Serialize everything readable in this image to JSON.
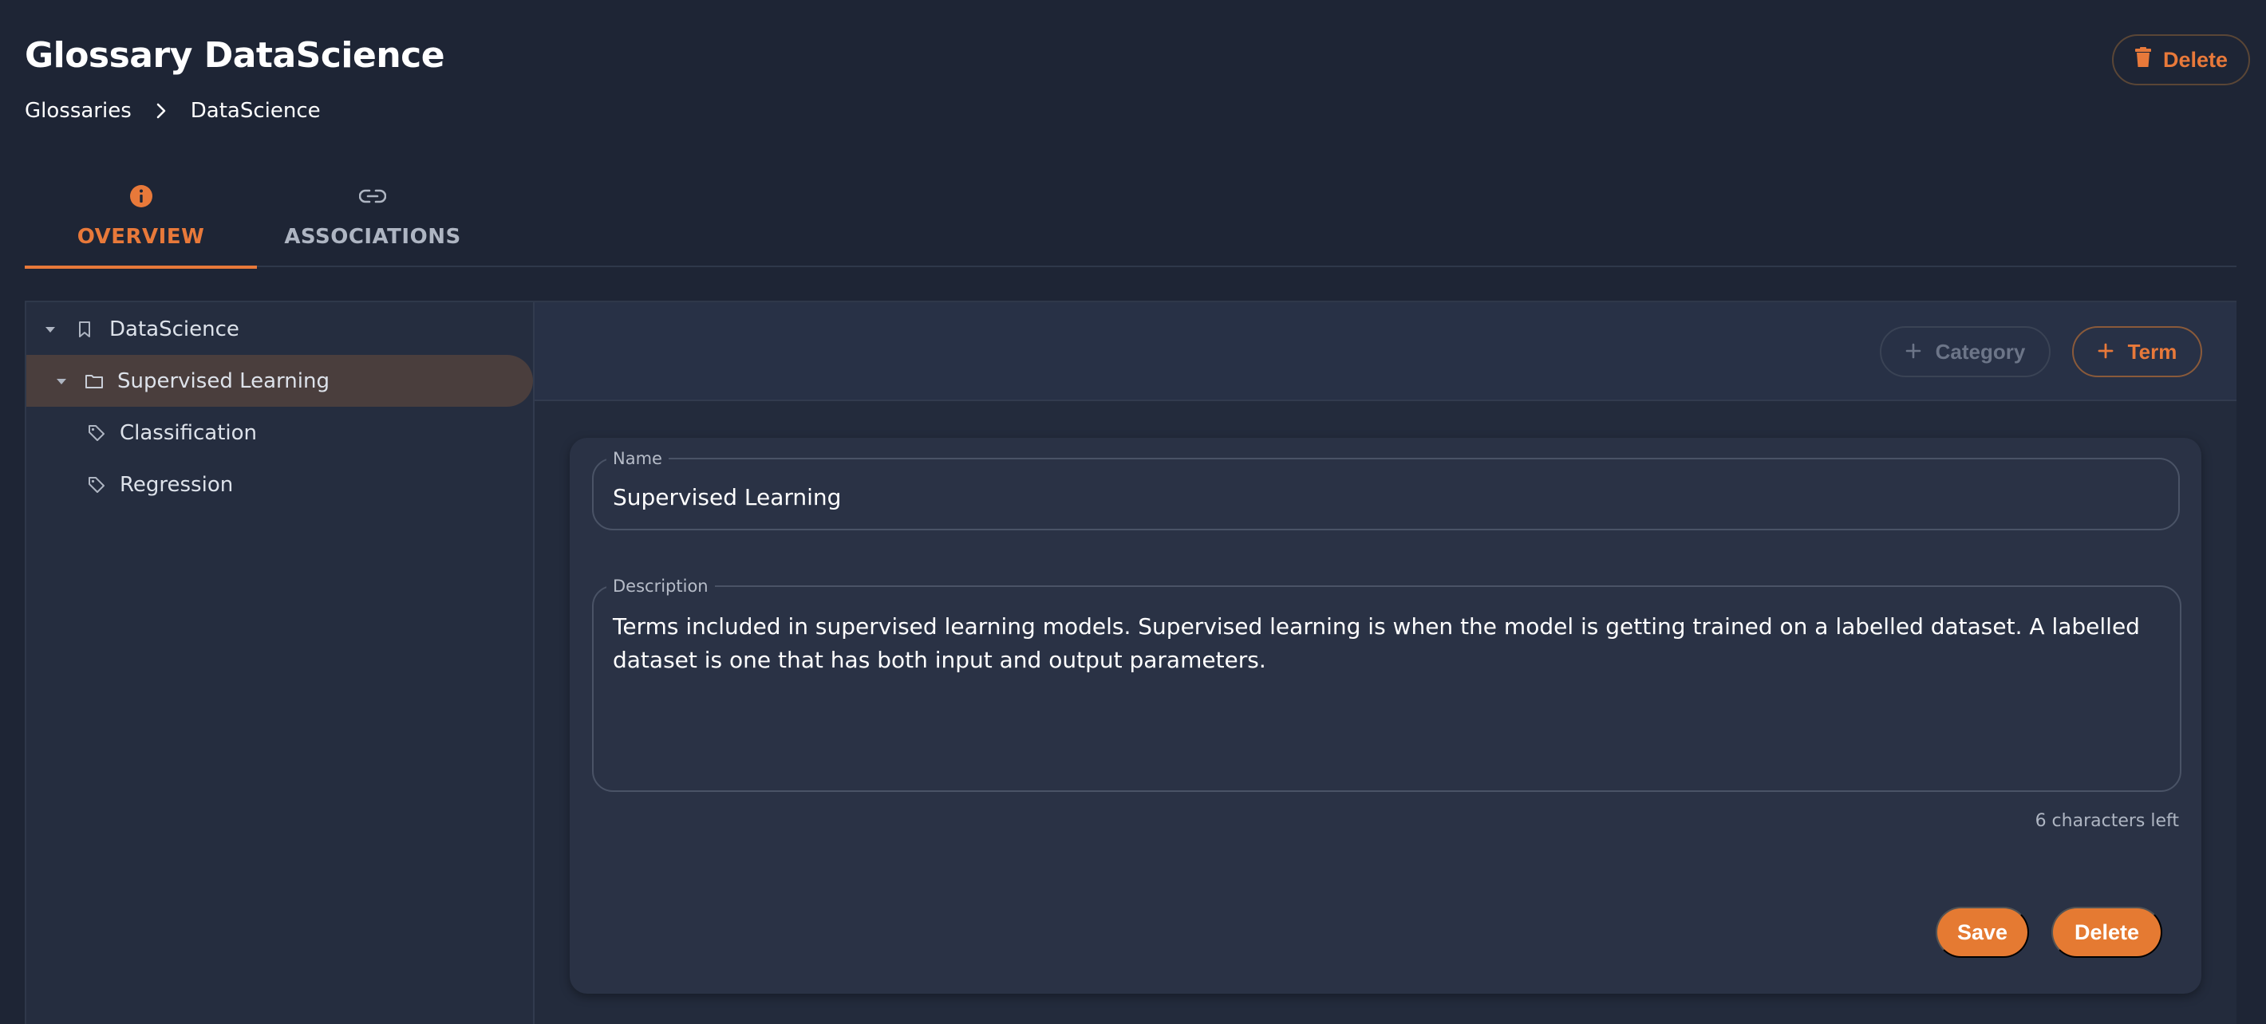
{
  "header": {
    "title": "Glossary DataScience",
    "delete_label": "Delete"
  },
  "breadcrumb": {
    "items": [
      "Glossaries",
      "DataScience"
    ]
  },
  "tabs": [
    {
      "label": "OVERVIEW",
      "icon": "info-icon",
      "active": true
    },
    {
      "label": "ASSOCIATIONS",
      "icon": "link-icon",
      "active": false
    }
  ],
  "tree": {
    "items": [
      {
        "label": "DataScience",
        "icon": "bookmark-icon",
        "expanded": true
      },
      {
        "label": "Supervised Learning",
        "icon": "folder-icon",
        "expanded": true,
        "selected": true
      },
      {
        "label": "Classification",
        "icon": "tag-icon"
      },
      {
        "label": "Regression",
        "icon": "tag-icon"
      }
    ]
  },
  "toolbar": {
    "category_label": "Category",
    "term_label": "Term"
  },
  "form": {
    "name_label": "Name",
    "name_value": "Supervised Learning",
    "description_label": "Description",
    "description_value": "Terms included in supervised learning models. Supervised learning is when the model is getting trained on a labelled dataset. A labelled dataset is one that has both input and output parameters.",
    "chars_left": "6 characters left",
    "save_label": "Save",
    "delete_label": "Delete"
  },
  "colors": {
    "accent": "#e8793a",
    "background": "#1e2535",
    "panel": "#252d3f"
  }
}
